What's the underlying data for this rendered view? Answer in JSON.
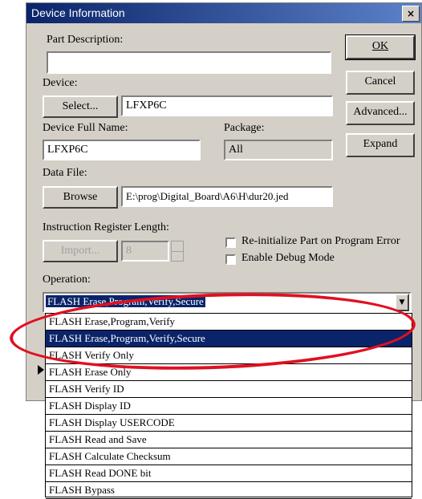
{
  "window": {
    "title": "Device Information",
    "close_glyph": "×"
  },
  "part_description": {
    "label": "Part Description:",
    "value": ""
  },
  "device": {
    "label": "Device:",
    "select_button": "Select...",
    "value": "LFXP6C"
  },
  "device_full_name": {
    "label": "Device Full Name:",
    "value": "LFXP6C"
  },
  "package": {
    "label": "Package:",
    "value": "All"
  },
  "data_file": {
    "label": "Data File:",
    "browse_button": "Browse",
    "value": "E:\\prog\\Digital_Board\\A6\\H\\dur20.jed"
  },
  "instruction_register": {
    "label": "Instruction Register Length:",
    "import_button": "Import...",
    "value": "8"
  },
  "options": {
    "reinitialize": "Re-initialize Part on Program Error",
    "debug": "Enable Debug Mode"
  },
  "operation": {
    "label": "Operation:",
    "selected": "FLASH Erase,Program,Verify,Secure",
    "dropdown_items": [
      "FLASH Erase,Program,Verify",
      "FLASH Erase,Program,Verify,Secure",
      "FLASH Verify Only",
      "FLASH Erase Only",
      "FLASH Verify ID",
      "FLASH Display ID",
      "FLASH Display USERCODE",
      "FLASH Read and Save",
      "FLASH Calculate Checksum",
      "FLASH Read DONE bit",
      "FLASH Bypass"
    ],
    "highlighted_index": 1
  },
  "buttons": {
    "ok": "OK",
    "cancel": "Cancel",
    "advanced": "Advanced...",
    "expand": "Expand"
  },
  "icons": {
    "dropdown_arrow": "▼",
    "pointer": "arrow-right-icon"
  },
  "colors": {
    "title_bar": "#0a246a",
    "selection": "#0a246a",
    "annotation": "#e01020"
  }
}
